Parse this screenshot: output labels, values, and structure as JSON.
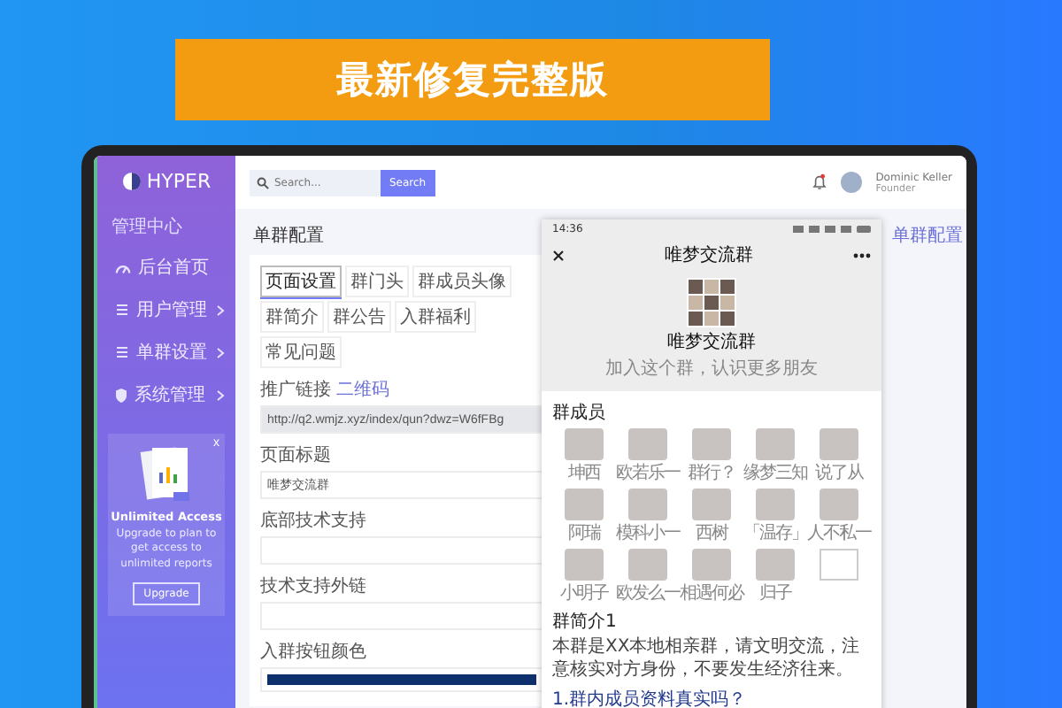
{
  "banner": {
    "text": "最新修复完整版"
  },
  "sidebar": {
    "logo": "HYPER",
    "section": "管理中心",
    "items": [
      {
        "label": "后台首页",
        "kind": "gauge",
        "expandable": false
      },
      {
        "label": "用户管理",
        "kind": "list",
        "expandable": true
      },
      {
        "label": "单群设置",
        "kind": "list",
        "expandable": true
      },
      {
        "label": "系统管理",
        "kind": "shield",
        "expandable": true
      }
    ],
    "promo": {
      "close": "x",
      "title": "Unlimited Access",
      "text": "Upgrade to plan to get access to unlimited reports",
      "button": "Upgrade"
    }
  },
  "topbar": {
    "search_placeholder": "Search...",
    "search_button": "Search",
    "user_name": "Dominic Keller",
    "user_role": "Founder"
  },
  "page": {
    "title": "单群配置",
    "breadcrumb": "单群配置",
    "tabs": [
      {
        "label": "页面设置",
        "selected": true
      },
      {
        "label": "群门头",
        "selected": false
      },
      {
        "label": "群成员头像",
        "selected": false
      },
      {
        "label": "群简介",
        "selected": false
      },
      {
        "label": "群公告",
        "selected": false
      },
      {
        "label": "入群福利",
        "selected": false
      },
      {
        "label": "常见问题",
        "selected": false
      }
    ],
    "fields": [
      {
        "kind": "text",
        "label": "推广链接",
        "link": "二维码",
        "value": "http://q2.wmjz.xyz/index/qun?dwz=W6fFBg",
        "disabled": true
      },
      {
        "kind": "text",
        "label": "页面标题",
        "value": "唯梦交流群",
        "disabled": false
      },
      {
        "kind": "text",
        "label": "底部技术支持",
        "disabled": false
      },
      {
        "kind": "text",
        "label": "技术支持外链",
        "disabled": false
      },
      {
        "kind": "color",
        "label": "入群按钮颜色",
        "color": "#0d2f6b"
      }
    ]
  },
  "phone": {
    "time": "14:36",
    "title": "唯梦交流群",
    "group_name": "唯梦交流群",
    "group_subtitle": "加入这个群，认识更多朋友",
    "members_heading": "群成员",
    "members": [
      {
        "kind": "photo",
        "name": "坤西"
      },
      {
        "kind": "photo",
        "name": "欧若乐一"
      },
      {
        "kind": "photo",
        "name": "群行？"
      },
      {
        "kind": "photo",
        "name": "缘梦三知"
      },
      {
        "kind": "photo",
        "name": "说了从"
      },
      {
        "kind": "photo",
        "name": "阿瑞"
      },
      {
        "kind": "photo",
        "name": "模科小一"
      },
      {
        "kind": "photo",
        "name": "西树"
      },
      {
        "kind": "photo",
        "name": "「温存」"
      },
      {
        "kind": "photo",
        "name": "人不私一"
      },
      {
        "kind": "photo",
        "name": "小明子"
      },
      {
        "kind": "photo",
        "name": "欧发么一"
      },
      {
        "kind": "photo",
        "name": "相遇何必"
      },
      {
        "kind": "photo",
        "name": "归子"
      },
      {
        "kind": "broken"
      }
    ],
    "intro_heading": "群简介1",
    "intro_text": "本群是XX本地相亲群，请文明交流，注意核实对方身份，不要发生经济往来。",
    "question": "1.群内成员资料真实吗？"
  }
}
